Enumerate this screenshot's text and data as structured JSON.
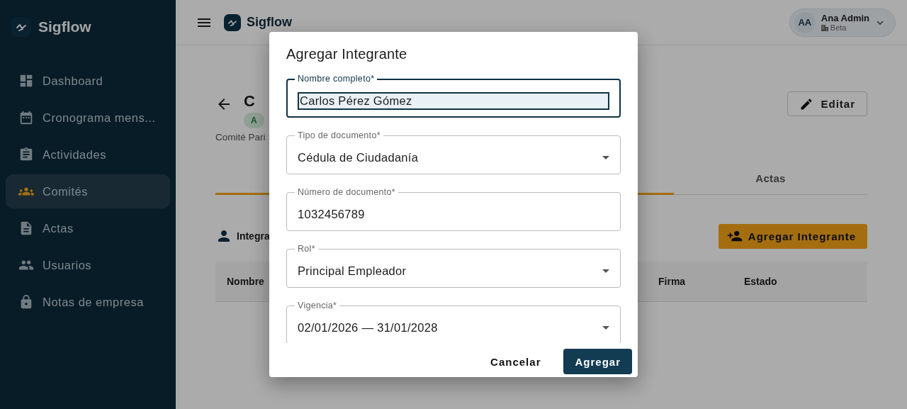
{
  "sidebar": {
    "brand": "Sigflow",
    "items": [
      {
        "label": "Dashboard",
        "selected": false
      },
      {
        "label": "Cronograma mens...",
        "selected": false
      },
      {
        "label": "Actividades",
        "selected": false
      },
      {
        "label": "Comités",
        "selected": true
      },
      {
        "label": "Actas",
        "selected": false
      },
      {
        "label": "Usuarios",
        "selected": false
      },
      {
        "label": "Notas de empresa",
        "selected": false
      }
    ]
  },
  "topbar": {
    "brand": "Sigflow",
    "user": {
      "initials": "AA",
      "name": "Ana Admin",
      "company": "Beta"
    }
  },
  "page": {
    "title": "C",
    "badge": "A",
    "subtitle": "Comité Pari",
    "edit_button": "Editar",
    "tabs": [
      {
        "selected": true
      },
      {
        "label": "Actas",
        "selected": false
      }
    ],
    "section_title": "Integra",
    "add_button": "Agregar Integrante",
    "table": {
      "columns": [
        "Nombre",
        "Firma",
        "Estado"
      ]
    }
  },
  "dialog": {
    "title": "Agregar Integrante",
    "fields": [
      {
        "kind": "text",
        "label": "Nombre completo*",
        "value": "Carlos Pérez Gómez",
        "focused": true
      },
      {
        "kind": "select",
        "label": "Tipo de documento*",
        "value": "Cédula de Ciudadanía",
        "focused": false
      },
      {
        "kind": "text",
        "label": "Número de documento*",
        "value": "1032456789",
        "focused": false
      },
      {
        "kind": "select",
        "label": "Rol*",
        "value": "Principal Empleador",
        "focused": false
      },
      {
        "kind": "select",
        "label": "Vigencia*",
        "value": "02/01/2026 — 31/01/2028",
        "focused": false
      }
    ],
    "buttons": [
      {
        "kind": "text",
        "label": "Cancelar"
      },
      {
        "kind": "primary",
        "label": "Agregar"
      }
    ]
  }
}
